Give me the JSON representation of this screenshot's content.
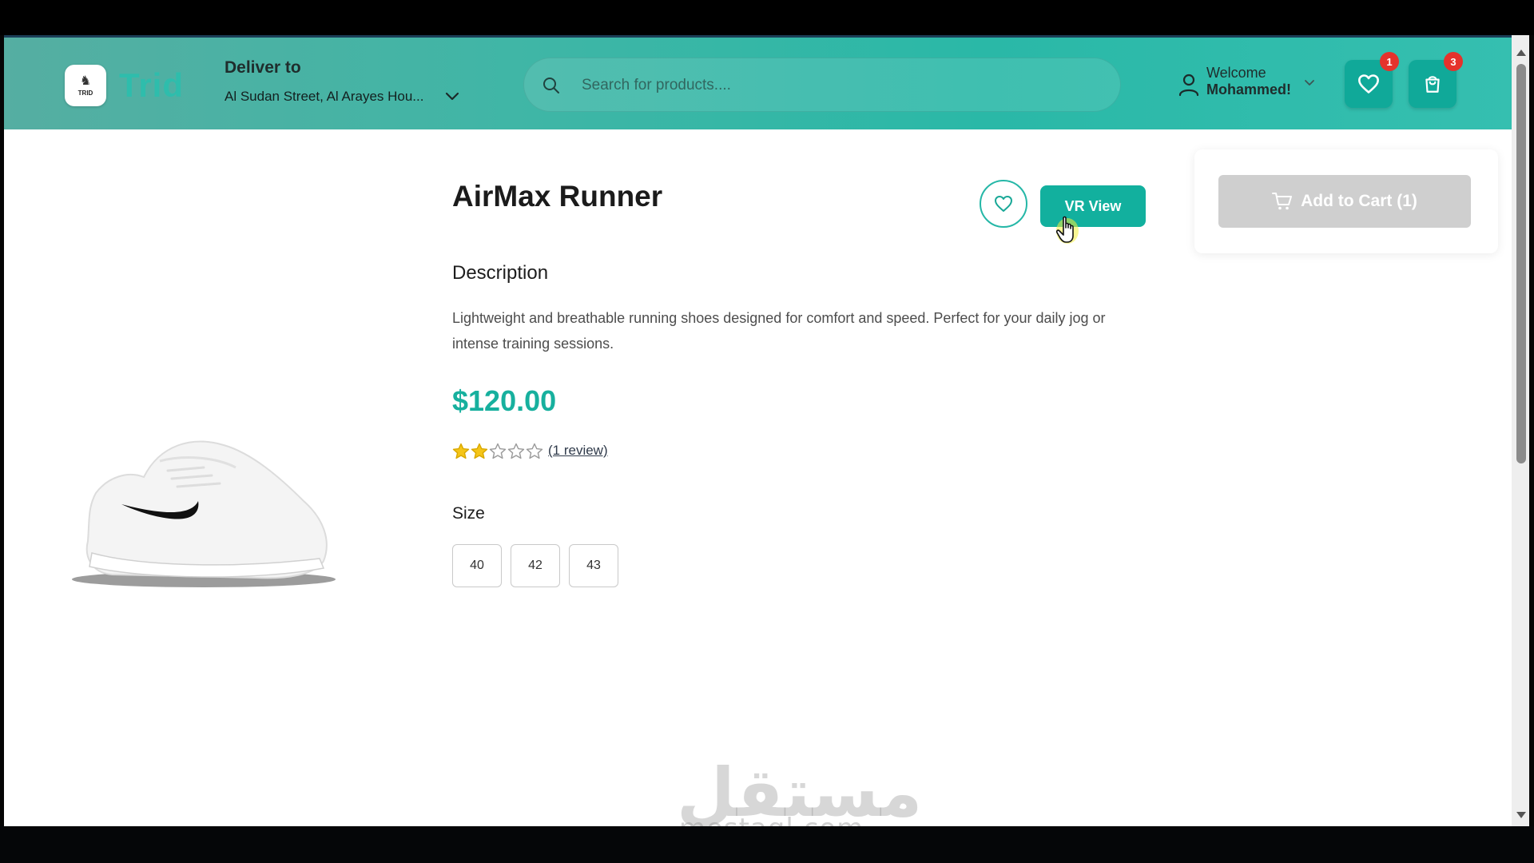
{
  "header": {
    "logo_text": "TRID",
    "brand": "Trid",
    "deliver_title": "Deliver to",
    "deliver_address": "Al Sudan Street, Al Arayes Hou...",
    "search_placeholder": "Search for products....",
    "welcome": "Welcome",
    "user_name": "Mohammed!",
    "wishlist_count": "1",
    "cart_count": "3"
  },
  "product": {
    "title": "AirMax Runner",
    "vr_label": "VR View",
    "description_heading": "Description",
    "description": "Lightweight and breathable running shoes designed for comfort and speed. Perfect for your daily jog or intense training sessions.",
    "price": "$120.00",
    "rating": 2,
    "rating_max": 5,
    "review_link": "(1 review)",
    "size_heading": "Size",
    "sizes": [
      "40",
      "42",
      "43"
    ]
  },
  "cart": {
    "add_label": "Add to Cart (1)"
  },
  "watermark": {
    "arabic": "مستقل",
    "latin": "mostaql.com"
  },
  "colors": {
    "accent": "#12b09e",
    "header_gradient_start": "#55aea2",
    "header_gradient_end": "#35bfb0",
    "badge": "#e5322c",
    "star_filled": "#f5c518",
    "button_disabled": "#cfcfcf"
  }
}
